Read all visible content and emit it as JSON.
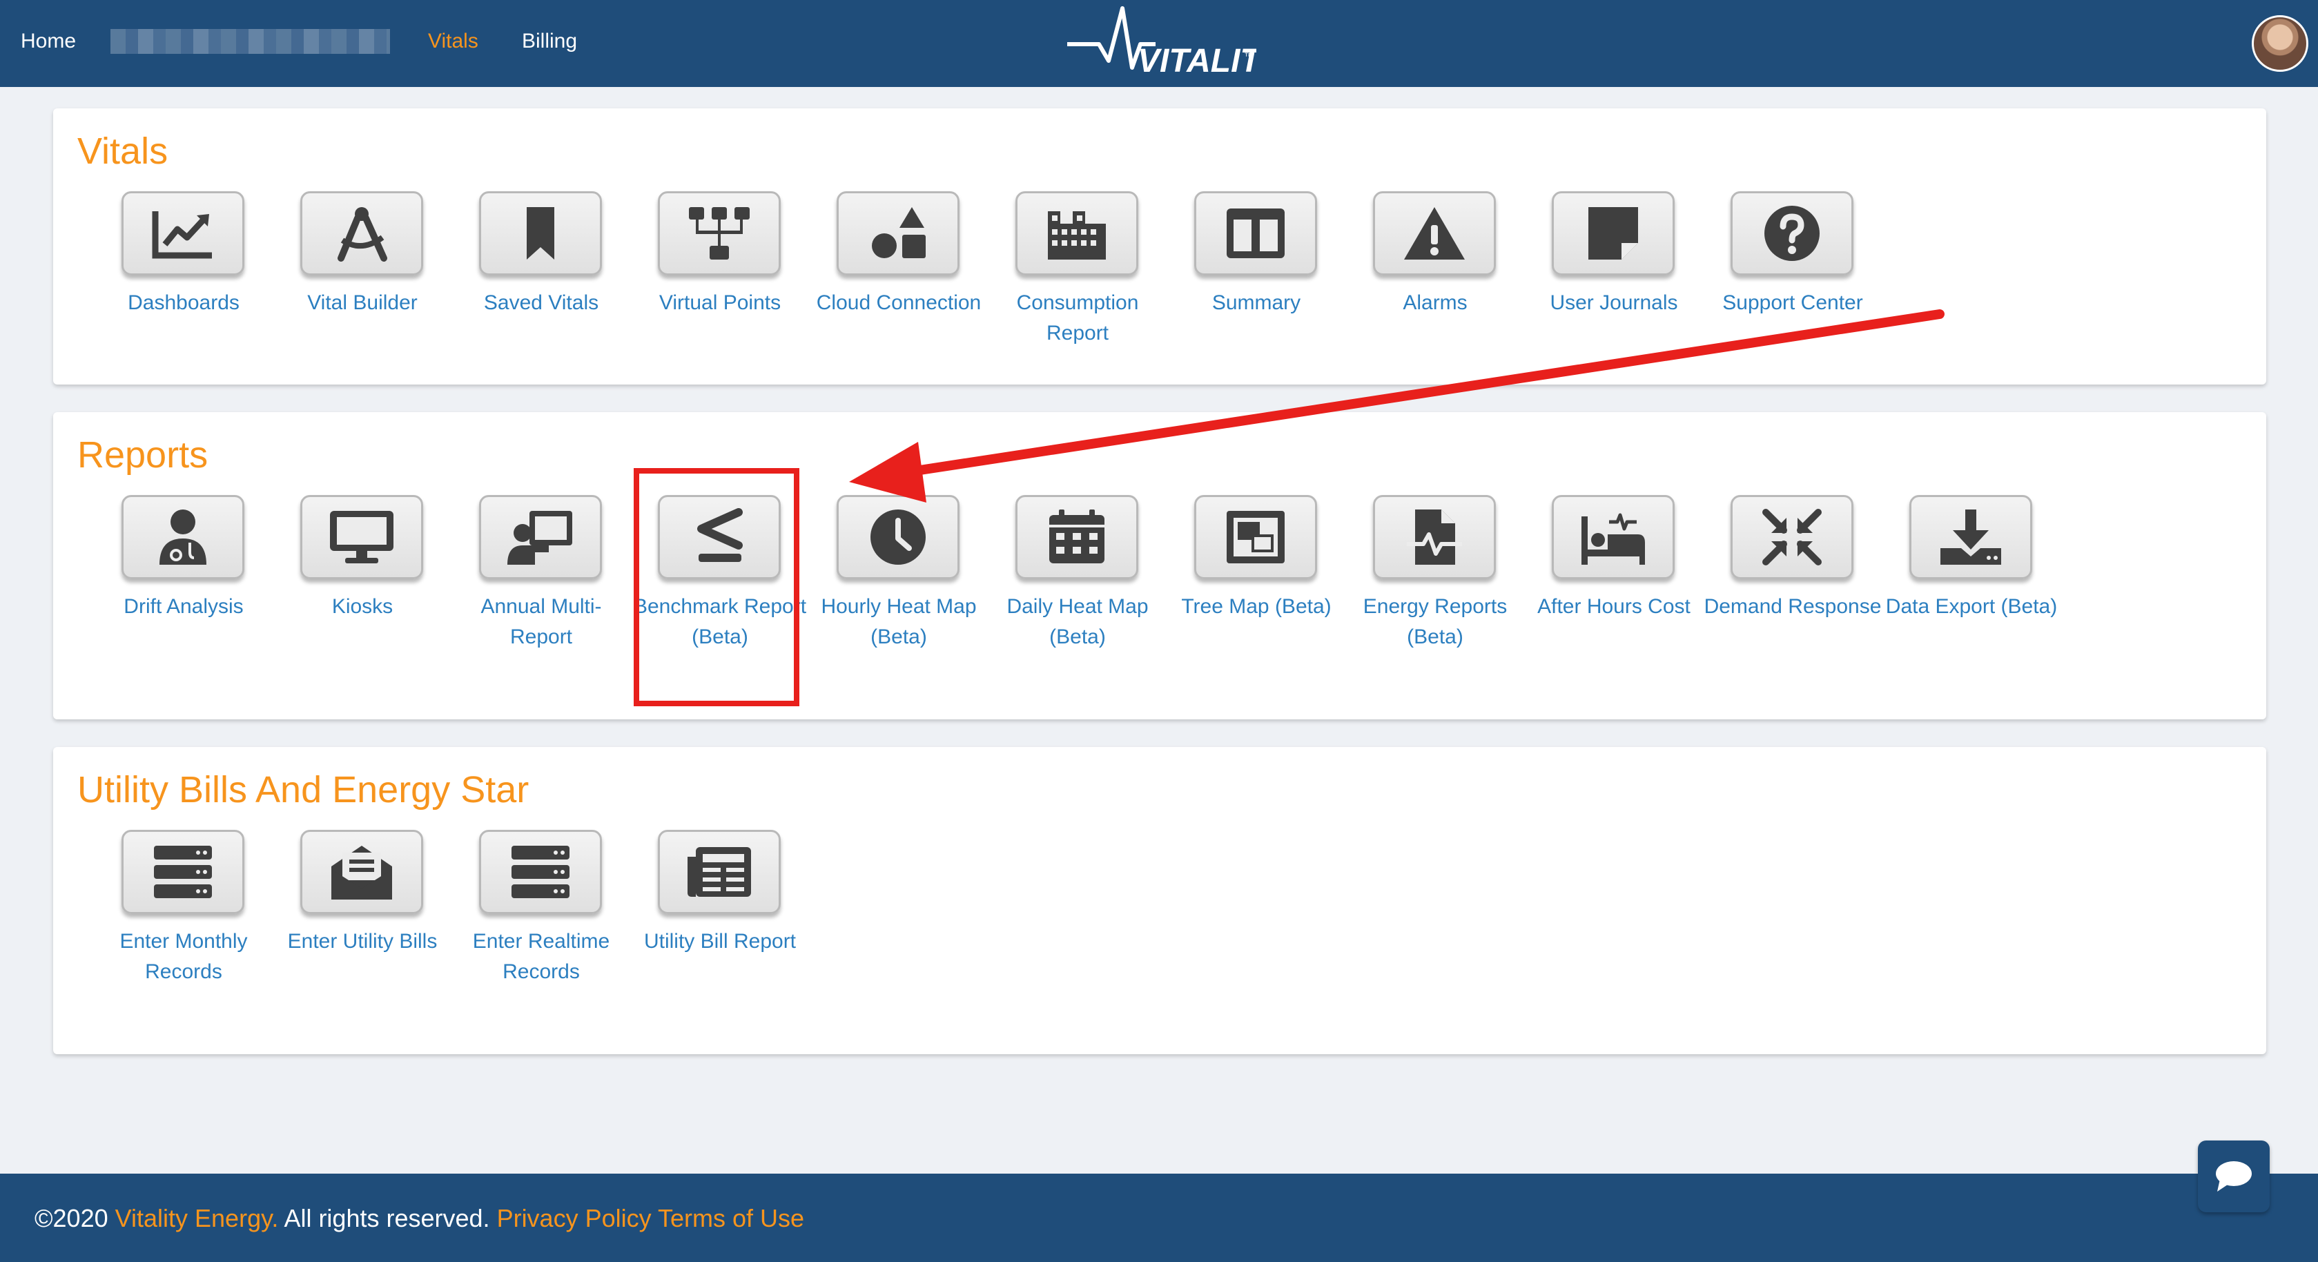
{
  "nav": {
    "home": "Home",
    "vitals": "Vitals",
    "billing": "Billing",
    "logo_text": "VITALITY",
    "logo_tm": "™"
  },
  "sections": {
    "vitals": {
      "title": "Vitals",
      "items": [
        {
          "label": "Dashboards",
          "icon": "chart-line-icon"
        },
        {
          "label": "Vital Builder",
          "icon": "drafting-compass-icon"
        },
        {
          "label": "Saved Vitals",
          "icon": "bookmark-icon"
        },
        {
          "label": "Virtual Points",
          "icon": "network-tree-icon"
        },
        {
          "label": "Cloud Connection",
          "icon": "shapes-icon"
        },
        {
          "label": "Consumption Report",
          "icon": "industry-icon"
        },
        {
          "label": "Summary",
          "icon": "columns-icon"
        },
        {
          "label": "Alarms",
          "icon": "warning-icon"
        },
        {
          "label": "User Journals",
          "icon": "sticky-note-icon"
        },
        {
          "label": "Support Center",
          "icon": "question-circle-icon"
        }
      ]
    },
    "reports": {
      "title": "Reports",
      "items": [
        {
          "label": "Drift Analysis",
          "icon": "user-doctor-icon"
        },
        {
          "label": "Kiosks",
          "icon": "desktop-icon"
        },
        {
          "label": "Annual Multi-Report",
          "icon": "chalkboard-teacher-icon"
        },
        {
          "label": "Benchmark Report (Beta)",
          "icon": "less-than-equal-icon"
        },
        {
          "label": "Hourly Heat Map (Beta)",
          "icon": "clock-icon"
        },
        {
          "label": "Daily Heat Map (Beta)",
          "icon": "calendar-icon"
        },
        {
          "label": "Tree Map (Beta)",
          "icon": "object-group-icon"
        },
        {
          "label": "Energy Reports (Beta)",
          "icon": "file-medical-alt-icon"
        },
        {
          "label": "After Hours Cost",
          "icon": "bed-icon"
        },
        {
          "label": "Demand Response",
          "icon": "compress-arrows-icon"
        },
        {
          "label": "Data Export (Beta)",
          "icon": "download-icon"
        }
      ]
    },
    "utility": {
      "title": "Utility Bills And Energy Star",
      "items": [
        {
          "label": "Enter Monthly Records",
          "icon": "server-icon"
        },
        {
          "label": "Enter Utility Bills",
          "icon": "envelope-open-text-icon"
        },
        {
          "label": "Enter Realtime Records",
          "icon": "server-icon"
        },
        {
          "label": "Utility Bill Report",
          "icon": "newspaper-icon"
        }
      ]
    }
  },
  "footer": {
    "copyright": "©2020",
    "company": "Vitality Energy.",
    "rights": "All rights reserved.",
    "privacy": "Privacy Policy",
    "terms": "Terms of Use"
  },
  "colors": {
    "nav_bg": "#1f4d7a",
    "accent": "#f7941d",
    "link": "#2c7fc0",
    "annotation": "#e8201c"
  }
}
